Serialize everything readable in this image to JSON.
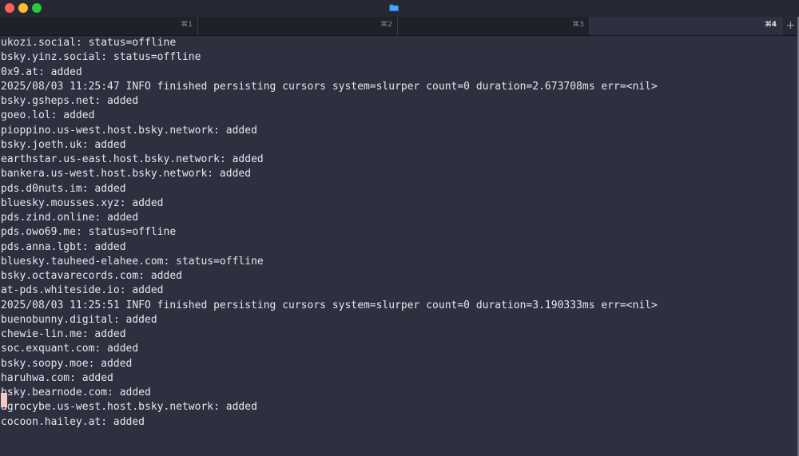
{
  "window": {
    "title_icon": "folder-icon",
    "colors": {
      "background": "#2e3040",
      "text": "#e6e6ea",
      "cursor": "#f2c9c0"
    }
  },
  "tabs": [
    {
      "shortcut": "⌘1",
      "active": false
    },
    {
      "shortcut": "⌘2",
      "active": false
    },
    {
      "shortcut": "⌘3",
      "active": false
    },
    {
      "shortcut": "⌘4",
      "active": true
    }
  ],
  "new_tab_label": "+",
  "terminal_lines": [
    "ukozi.social: status=offline",
    "bsky.yinz.social: status=offline",
    "0x9.at: added",
    "2025/08/03 11:25:47 INFO finished persisting cursors system=slurper count=0 duration=2.673708ms err=<nil>",
    "bsky.gsheps.net: added",
    "goeo.lol: added",
    "pioppino.us-west.host.bsky.network: added",
    "bsky.joeth.uk: added",
    "earthstar.us-east.host.bsky.network: added",
    "bankera.us-west.host.bsky.network: added",
    "pds.d0nuts.im: added",
    "bluesky.mousses.xyz: added",
    "pds.zind.online: added",
    "pds.owo69.me: status=offline",
    "pds.anna.lgbt: added",
    "bluesky.tauheed-elahee.com: status=offline",
    "bsky.octavarecords.com: added",
    "at-pds.whiteside.io: added",
    "2025/08/03 11:25:51 INFO finished persisting cursors system=slurper count=0 duration=3.190333ms err=<nil>",
    "buenobunny.digital: added",
    "chewie-lin.me: added",
    "soc.exquant.com: added",
    "bsky.soopy.moe: added",
    "haruhwa.com: added",
    "bsky.bearnode.com: added",
    "agrocybe.us-west.host.bsky.network: added",
    "cocoon.hailey.at: added"
  ]
}
